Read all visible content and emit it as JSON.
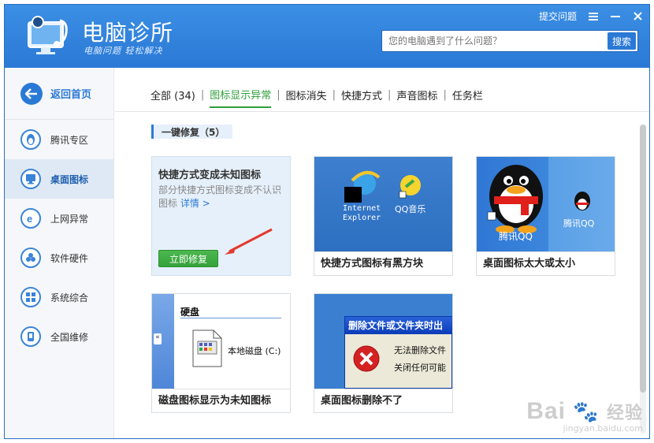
{
  "app": {
    "title": "电脑诊所",
    "slogan": "电脑问题 轻松解决"
  },
  "top_actions": {
    "feedback": "提交问题"
  },
  "search": {
    "placeholder": "您的电脑遇到了什么问题？",
    "button": "搜索"
  },
  "sidebar": {
    "back": "返回首页",
    "items": [
      {
        "label": "腾讯专区",
        "icon": "penguin-icon",
        "active": false
      },
      {
        "label": "桌面图标",
        "icon": "monitor-icon",
        "active": true
      },
      {
        "label": "上网异常",
        "icon": "internet-explorer-icon",
        "active": false
      },
      {
        "label": "软件硬件",
        "icon": "puzzle-icon",
        "active": false
      },
      {
        "label": "系统综合",
        "icon": "windows-icon",
        "active": false
      },
      {
        "label": "全国维修",
        "icon": "phone-icon",
        "active": false
      }
    ]
  },
  "tabs": [
    {
      "label": "全部 (34)",
      "active": false
    },
    {
      "label": "图标显示异常",
      "active": true
    },
    {
      "label": "图标消失",
      "active": false
    },
    {
      "label": "快捷方式",
      "active": false
    },
    {
      "label": "声音图标",
      "active": false
    },
    {
      "label": "任务栏",
      "active": false
    }
  ],
  "section": {
    "title": "一键修复（5）"
  },
  "fix_card": {
    "title": "快捷方式变成未知图标",
    "desc": "部分快捷方式图标变成不认识图标",
    "detail": "详情 >",
    "button": "立即修复"
  },
  "cards": [
    {
      "caption": "快捷方式图标有黑方块",
      "thumb": {
        "ie_label_1": "Internet",
        "ie_label_2": "Explorer",
        "qq_music": "QQ音乐"
      }
    },
    {
      "caption": "桌面图标太大或太小",
      "thumb": {
        "qq_big": "腾讯QQ",
        "qq_small": "腾讯QQ"
      }
    },
    {
      "caption": "磁盘图标显示为未知图标",
      "thumb": {
        "header": "硬盘",
        "disk_label": "本地磁盘 (C:)"
      }
    },
    {
      "caption": "桌面图标删除不了",
      "thumb": {
        "dialog_title": "删除文件或文件夹时出",
        "line1": "无法删除文件",
        "line2": "关闭任何可能"
      }
    }
  ],
  "watermark": {
    "brand": "Bai",
    "brand_suffix": "经验",
    "domain": "jingyan.baidu.com"
  },
  "colors": {
    "header_blue": "#2b79d6",
    "active_green": "#2e9e3a",
    "sidebar_bg": "#f5f7fa"
  }
}
